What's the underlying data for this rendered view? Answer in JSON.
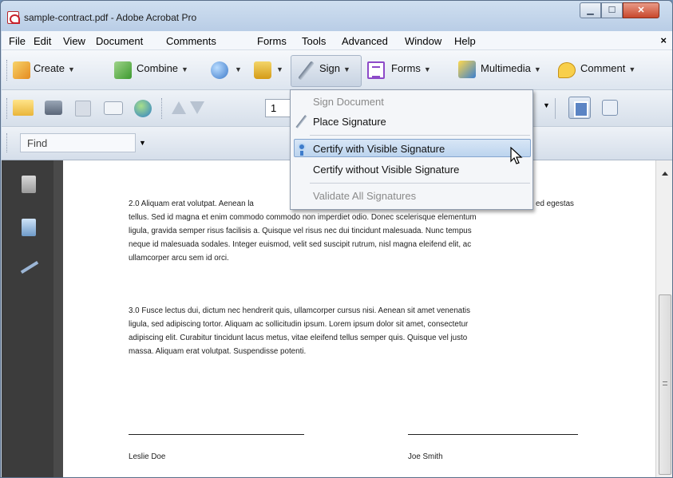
{
  "window": {
    "title": "sample-contract.pdf - Adobe Acrobat Pro"
  },
  "menubar": [
    "File",
    "Edit",
    "View",
    "Document",
    "Comments",
    "Forms",
    "Tools",
    "Advanced",
    "Window",
    "Help"
  ],
  "menubar_close": "×",
  "toolbar_tasks": {
    "create": "Create",
    "combine": "Combine",
    "sign": "Sign",
    "forms": "Forms",
    "multimedia": "Multimedia",
    "comment": "Comment"
  },
  "page_nav": {
    "page_number": "1"
  },
  "find": {
    "placeholder": "Find"
  },
  "sign_menu": {
    "sign_document": "Sign Document",
    "place_signature": "Place Signature",
    "certify_visible": "Certify with Visible Signature",
    "certify_invisible": "Certify without Visible Signature",
    "validate_all": "Validate All Signatures"
  },
  "document": {
    "para_2": "2.0 Aliquam erat volutpat. Aenean la… sed egestas tellus. Sed id magna et enim commodo commodo non imperdiet odio. Donec scelerisque elementum ligula, gravida semper risus facilisis a. Quisque vel risus nec dui tincidunt malesuada. Nunc tempus neque id malesuada sodales. Integer euismod, velit sed suscipit rutrum, nisl magna eleifend elit, ac ullamcorper arcu sem id orci.",
    "para_2_lines": [
      "2.0 Aliquam erat volutpat. Aenean la",
      "tellus. Sed id magna et enim commodo commodo non imperdiet odio. Donec scelerisque elementum",
      "ligula, gravida semper risus facilisis a. Quisque vel risus nec dui tincidunt malesuada. Nunc tempus",
      "neque id malesuada sodales. Integer euismod, velit sed suscipit rutrum, nisl magna eleifend elit, ac",
      "ullamcorper arcu sem id orci."
    ],
    "para_2_tail": "ed egestas",
    "para_3_lines": [
      "3.0 Fusce lectus dui, dictum nec hendrerit quis, ullamcorper cursus nisi. Aenean sit amet venenatis",
      "ligula, sed adipiscing tortor. Aliquam ac sollicitudin ipsum. Lorem ipsum dolor sit amet, consectetur",
      "adipiscing elit. Curabitur tincidunt lacus metus, vitae eleifend tellus semper quis. Quisque vel justo",
      "massa. Aliquam erat volutpat. Suspendisse potenti."
    ],
    "signer_left": "Leslie Doe",
    "signer_right": "Joe Smith"
  },
  "icons": {
    "app": "acrobat-pdf-icon",
    "nav": [
      "pages-icon",
      "bookmarks-icon",
      "signatures-icon"
    ]
  }
}
